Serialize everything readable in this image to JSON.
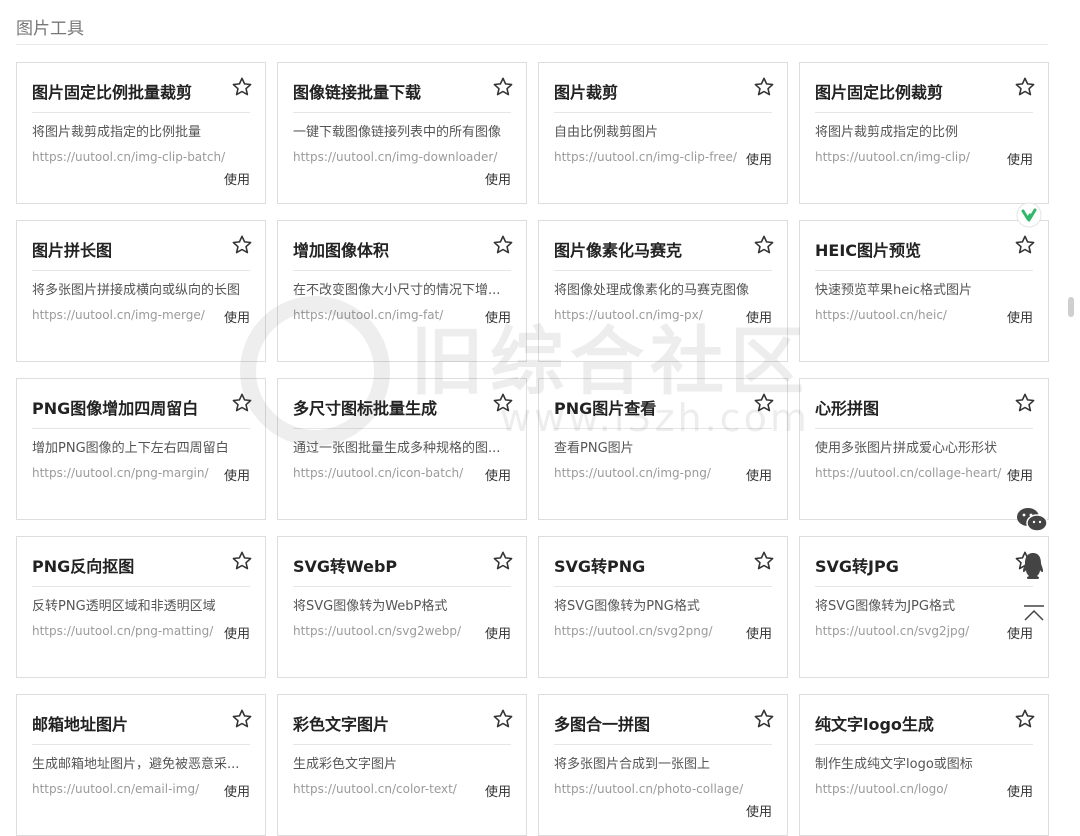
{
  "section": {
    "title": "图片工具"
  },
  "use_label": "使用",
  "cards": [
    {
      "title": "图片固定比例批量裁剪",
      "desc": "将图片裁剪成指定的比例批量",
      "url": "https://uutool.cn/img-clip-batch/",
      "use_wrap": true
    },
    {
      "title": "图像链接批量下载",
      "desc": "一键下载图像链接列表中的所有图像",
      "url": "https://uutool.cn/img-downloader/",
      "use_wrap": true
    },
    {
      "title": "图片裁剪",
      "desc": "自由比例裁剪图片",
      "url": "https://uutool.cn/img-clip-free/",
      "use_wrap": false
    },
    {
      "title": "图片固定比例裁剪",
      "desc": "将图片裁剪成指定的比例",
      "url": "https://uutool.cn/img-clip/",
      "use_wrap": false
    },
    {
      "title": "图片拼长图",
      "desc": "将多张图片拼接成横向或纵向的长图",
      "url": "https://uutool.cn/img-merge/",
      "use_wrap": false
    },
    {
      "title": "增加图像体积",
      "desc": "在不改变图像大小尺寸的情况下增...",
      "url": "https://uutool.cn/img-fat/",
      "use_wrap": false
    },
    {
      "title": "图片像素化马赛克",
      "desc": "将图像处理成像素化的马赛克图像",
      "url": "https://uutool.cn/img-px/",
      "use_wrap": false
    },
    {
      "title": "HEIC图片预览",
      "desc": "快速预览苹果heic格式图片",
      "url": "https://uutool.cn/heic/",
      "use_wrap": false
    },
    {
      "title": "PNG图像增加四周留白",
      "desc": "增加PNG图像的上下左右四周留白",
      "url": "https://uutool.cn/png-margin/",
      "use_wrap": false
    },
    {
      "title": "多尺寸图标批量生成",
      "desc": "通过一张图批量生成多种规格的图...",
      "url": "https://uutool.cn/icon-batch/",
      "use_wrap": false
    },
    {
      "title": "PNG图片查看",
      "desc": "查看PNG图片",
      "url": "https://uutool.cn/img-png/",
      "use_wrap": false
    },
    {
      "title": "心形拼图",
      "desc": "使用多张图片拼成爱心心形形状",
      "url": "https://uutool.cn/collage-heart/",
      "use_wrap": false
    },
    {
      "title": "PNG反向抠图",
      "desc": "反转PNG透明区域和非透明区域",
      "url": "https://uutool.cn/png-matting/",
      "use_wrap": false
    },
    {
      "title": "SVG转WebP",
      "desc": "将SVG图像转为WebP格式",
      "url": "https://uutool.cn/svg2webp/",
      "use_wrap": false
    },
    {
      "title": "SVG转PNG",
      "desc": "将SVG图像转为PNG格式",
      "url": "https://uutool.cn/svg2png/",
      "use_wrap": false
    },
    {
      "title": "SVG转JPG",
      "desc": "将SVG图像转为JPG格式",
      "url": "https://uutool.cn/svg2jpg/",
      "use_wrap": false
    },
    {
      "title": "邮箱地址图片",
      "desc": "生成邮箱地址图片，避免被恶意采...",
      "url": "https://uutool.cn/email-img/",
      "use_wrap": false
    },
    {
      "title": "彩色文字图片",
      "desc": "生成彩色文字图片",
      "url": "https://uutool.cn/color-text/",
      "use_wrap": false
    },
    {
      "title": "多图合一拼图",
      "desc": "将多张图片合成到一张图上",
      "url": "https://uutool.cn/photo-collage/",
      "use_wrap": true
    },
    {
      "title": "纯文字logo生成",
      "desc": "制作生成纯文字logo或图标",
      "url": "https://uutool.cn/logo/",
      "use_wrap": false
    }
  ],
  "watermark": {
    "text": "旧综合社区",
    "sub": "www.i3zh.com"
  },
  "floating": {
    "icons": [
      "yuque-icon",
      "wechat-icon",
      "qq-icon",
      "back-to-top-icon"
    ]
  },
  "colors": {
    "card_border": "#dddddd",
    "accent_green": "#31b96a"
  }
}
